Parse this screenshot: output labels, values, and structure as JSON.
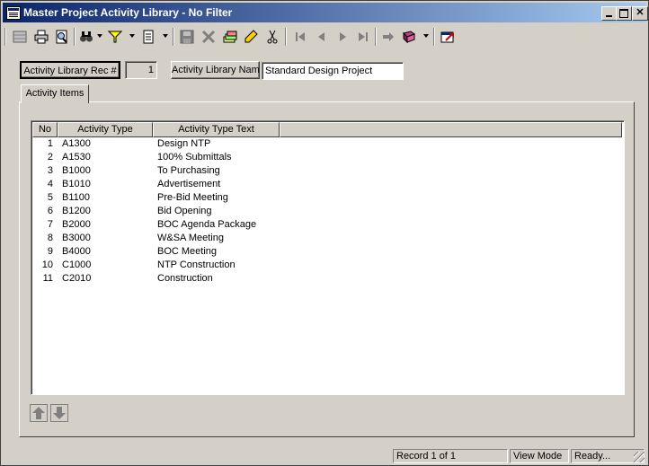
{
  "window": {
    "title": "Master Project Activity Library - No Filter"
  },
  "header": {
    "rec_button_label": "Activity Library Rec #",
    "rec_value": "1",
    "name_button_label": "Activity Library Name",
    "name_value": "Standard Design Project"
  },
  "tabs": [
    {
      "label": "Activity Items"
    }
  ],
  "grid": {
    "columns": [
      "No",
      "Activity Type",
      "Activity Type Text"
    ],
    "rows": [
      {
        "no": "1",
        "type": "A1300",
        "text": "Design NTP"
      },
      {
        "no": "2",
        "type": "A1530",
        "text": "100% Submittals"
      },
      {
        "no": "3",
        "type": "B1000",
        "text": "To Purchasing"
      },
      {
        "no": "4",
        "type": "B1010",
        "text": "Advertisement"
      },
      {
        "no": "5",
        "type": "B1100",
        "text": "Pre-Bid Meeting"
      },
      {
        "no": "6",
        "type": "B1200",
        "text": "Bid Opening"
      },
      {
        "no": "7",
        "type": "B2000",
        "text": "BOC Agenda Package"
      },
      {
        "no": "8",
        "type": "B3000",
        "text": "W&SA Meeting"
      },
      {
        "no": "9",
        "type": "B4000",
        "text": "BOC Meeting"
      },
      {
        "no": "10",
        "type": "C1000",
        "text": "NTP Construction"
      },
      {
        "no": "11",
        "type": "C2010",
        "text": "Construction"
      }
    ]
  },
  "status": {
    "record": "Record 1 of 1",
    "mode": "View Mode",
    "state": "Ready..."
  },
  "icons": {
    "toolbar": [
      "grid-icon",
      "print-icon",
      "print-preview-icon",
      "binoculars-icon",
      "filter-icon",
      "report-icon",
      "save-icon",
      "delete-icon",
      "add-icon",
      "edit-icon",
      "cut-icon",
      "first-record-icon",
      "previous-record-icon",
      "next-record-icon",
      "last-record-icon",
      "go-icon",
      "book-icon",
      "exit-icon"
    ],
    "grid": [
      "move-up-icon",
      "move-down-icon"
    ]
  },
  "colors": {
    "title_start": "#0a246a",
    "title_end": "#a6caf0",
    "face": "#d4d0c8"
  }
}
